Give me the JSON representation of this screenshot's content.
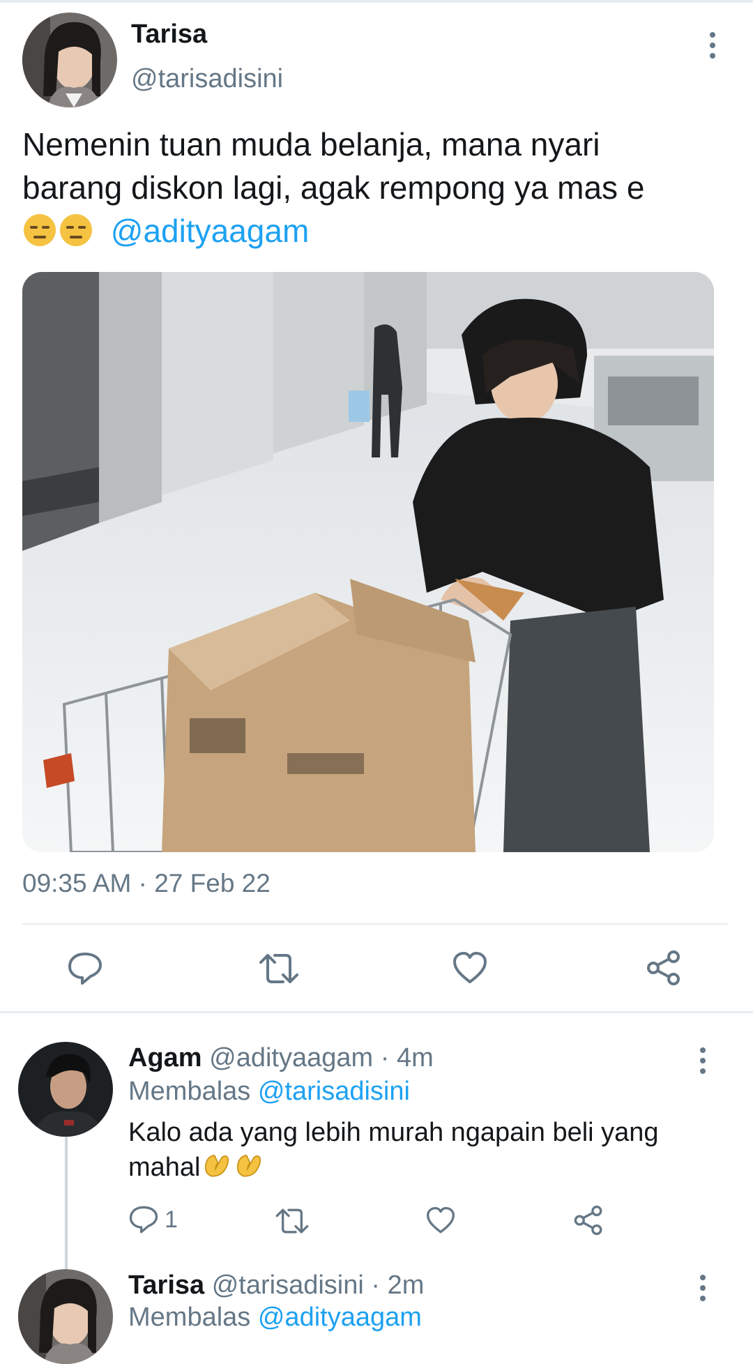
{
  "tweet": {
    "author_name": "Tarisa",
    "author_handle": "@tarisadisini",
    "text_line1": "Nemenin tuan muda belanja, mana nyari",
    "text_line2": "barang diskon lagi, agak rempong ya mas e",
    "mention": "@adityaagam",
    "emojis": [
      "expressionless-emoji",
      "expressionless-emoji"
    ],
    "timestamp": "09:35 AM · 27 Feb 22",
    "actions": [
      "reply-icon",
      "retweet-icon",
      "like-icon",
      "share-icon"
    ]
  },
  "replies": [
    {
      "author_name": "Agam",
      "author_handle": "@adityaagam",
      "time": "· 4m",
      "replying_label": "Membalas",
      "replying_to": "@tarisadisini",
      "text_line1": "Kalo ada yang lebih murah ngapain beli yang",
      "text_line2": "mahal",
      "emojis": [
        "pinching-hand-emoji",
        "pinching-hand-emoji"
      ],
      "reply_count": "1"
    },
    {
      "author_name": "Tarisa",
      "author_handle": "@tarisadisini",
      "time": "· 2m",
      "replying_label": "Membalas",
      "replying_to": "@adityaagam"
    }
  ],
  "colors": {
    "link": "#1da1f2",
    "muted": "#657786",
    "divider": "#e6ecf0",
    "emoji": "#f5c242"
  }
}
